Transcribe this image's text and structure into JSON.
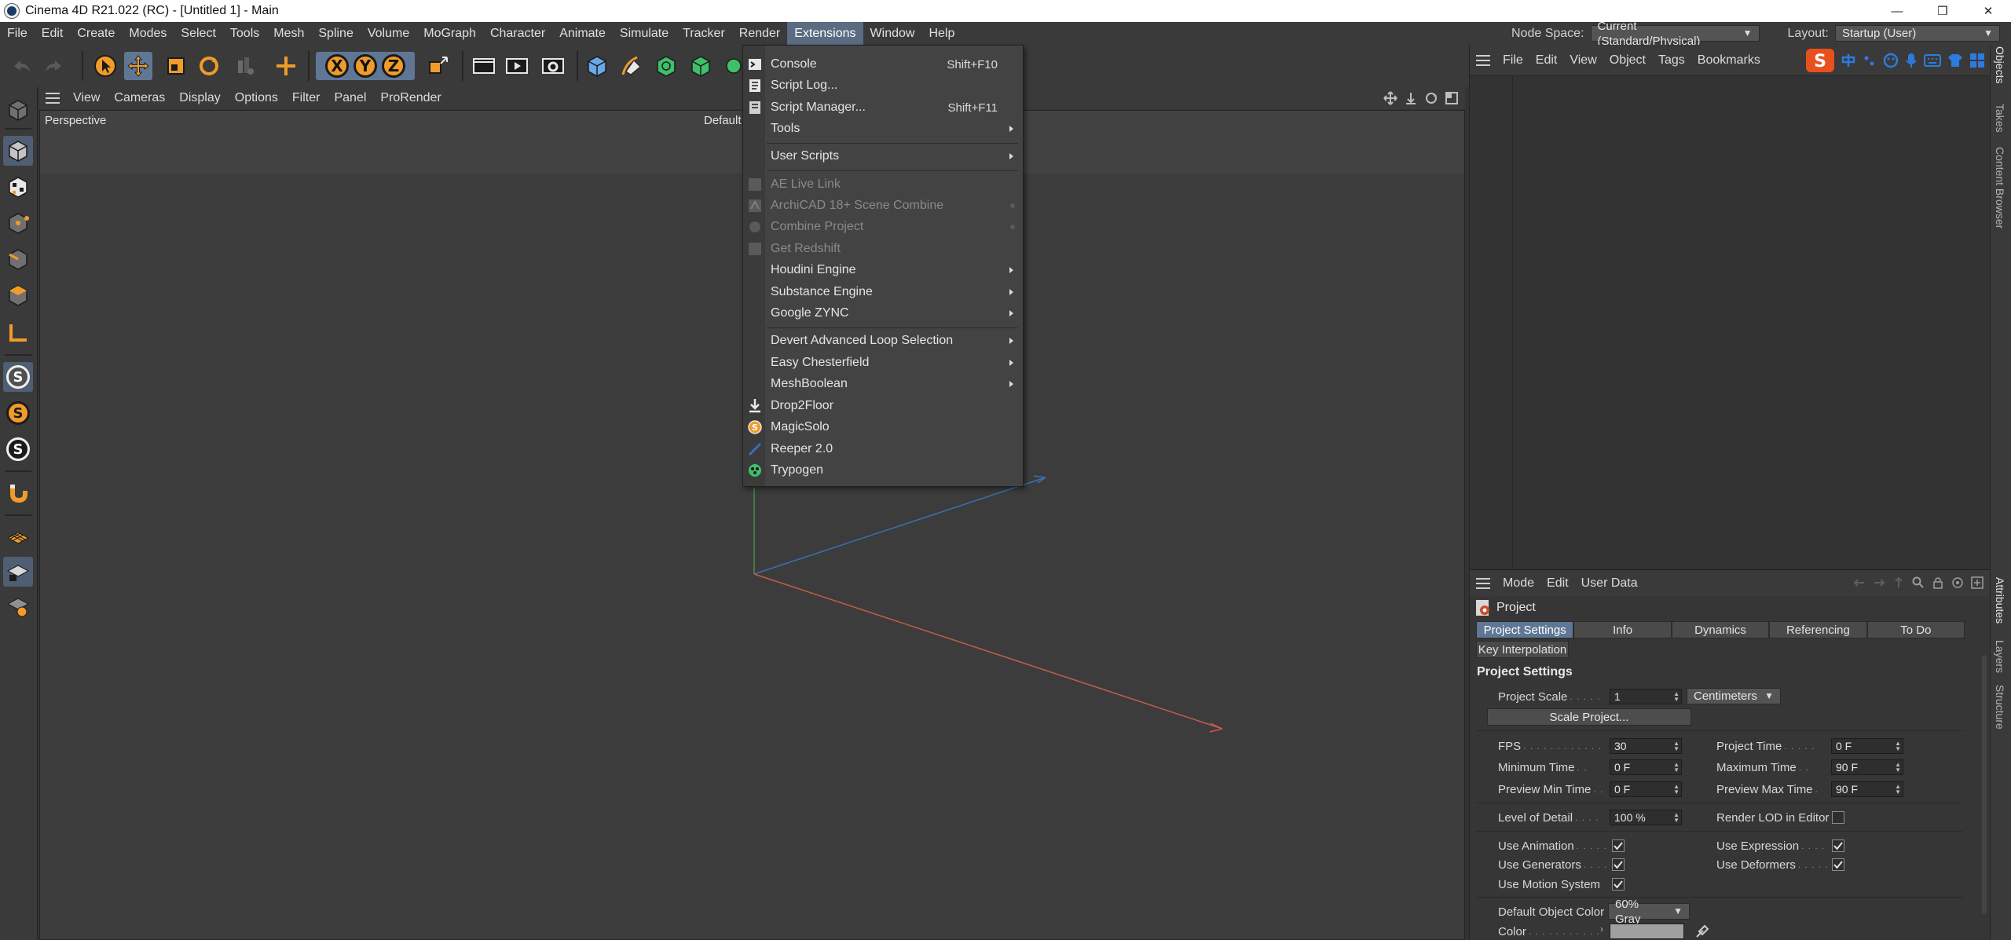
{
  "window": {
    "title": "Cinema 4D R21.022 (RC) - [Untitled 1] - Main",
    "controls": [
      "—",
      "❒",
      "✕"
    ]
  },
  "menubar": {
    "items": [
      "File",
      "Edit",
      "Create",
      "Modes",
      "Select",
      "Tools",
      "Mesh",
      "Spline",
      "Volume",
      "MoGraph",
      "Character",
      "Animate",
      "Simulate",
      "Tracker",
      "Render",
      "Extensions",
      "Window",
      "Help"
    ],
    "active": "Extensions",
    "node_space_label": "Node Space:",
    "node_space_value": "Current (Standard/Physical)",
    "layout_label": "Layout:",
    "layout_value": "Startup (User)"
  },
  "toolbar": {
    "axis_labels": [
      "X",
      "Y",
      "Z"
    ],
    "icons": [
      "undo-icon",
      "redo-icon",
      "live-selection-icon",
      "move-icon",
      "scale-icon",
      "rotate-icon",
      "recent-tools-icon",
      "world-coordinates-icon",
      "render-region-icon",
      "render-view-icon",
      "render-settings-icon",
      "cube-icon",
      "pen-icon",
      "subdivision-icon",
      "extrude-icon",
      "mograph-icon"
    ]
  },
  "left_toolbar": {
    "icons": [
      "make-editable-icon",
      "model-mode-icon",
      "texture-mode-icon",
      "points-mode-icon",
      "edges-mode-icon",
      "polygons-mode-icon",
      "axis-mode-icon",
      "solo-icon",
      "solo-hierarchy-icon",
      "solo-selection-icon",
      "snap-icon",
      "workplane-icon",
      "locked-workplane-icon",
      "planar-workplane-icon"
    ]
  },
  "viewport": {
    "menu": [
      "View",
      "Cameras",
      "Display",
      "Options",
      "Filter",
      "Panel",
      "ProRender"
    ],
    "camera_label": "Perspective",
    "default_label": "Default"
  },
  "extensions_menu": {
    "items": [
      {
        "label": "Console",
        "shortcut": "Shift+F10",
        "icon": "console-icon",
        "disabled": false,
        "submenu": false
      },
      {
        "label": "Script Log...",
        "shortcut": "",
        "icon": "script-log-icon",
        "disabled": false,
        "submenu": false
      },
      {
        "label": "Script Manager...",
        "shortcut": "Shift+F11",
        "icon": "script-manager-icon",
        "disabled": false,
        "submenu": false
      },
      {
        "label": "Tools",
        "shortcut": "",
        "icon": "",
        "disabled": false,
        "submenu": true
      },
      {
        "label": "User Scripts",
        "shortcut": "",
        "icon": "",
        "disabled": false,
        "submenu": true
      },
      {
        "label": "AE Live Link",
        "shortcut": "",
        "icon": "ae-live-link-icon",
        "disabled": true,
        "submenu": false
      },
      {
        "label": "ArchiCAD 18+ Scene Combine",
        "shortcut": "",
        "icon": "archicad-icon",
        "disabled": true,
        "submenu": false
      },
      {
        "label": "Combine Project",
        "shortcut": "",
        "icon": "combine-project-icon",
        "disabled": true,
        "submenu": false
      },
      {
        "label": "Get Redshift",
        "shortcut": "",
        "icon": "redshift-icon",
        "disabled": true,
        "submenu": false
      },
      {
        "label": "Houdini Engine",
        "shortcut": "",
        "icon": "",
        "disabled": false,
        "submenu": true
      },
      {
        "label": "Substance Engine",
        "shortcut": "",
        "icon": "",
        "disabled": false,
        "submenu": true
      },
      {
        "label": "Google ZYNC",
        "shortcut": "",
        "icon": "",
        "disabled": false,
        "submenu": true
      },
      {
        "label": "Devert Advanced Loop Selection",
        "shortcut": "",
        "icon": "",
        "disabled": false,
        "submenu": true
      },
      {
        "label": "Easy Chesterfield",
        "shortcut": "",
        "icon": "",
        "disabled": false,
        "submenu": true
      },
      {
        "label": "MeshBoolean",
        "shortcut": "",
        "icon": "",
        "disabled": false,
        "submenu": true
      },
      {
        "label": "Drop2Floor",
        "shortcut": "",
        "icon": "drop2floor-icon",
        "disabled": false,
        "submenu": false
      },
      {
        "label": "MagicSolo",
        "shortcut": "",
        "icon": "magicsolo-icon",
        "disabled": false,
        "submenu": false
      },
      {
        "label": "Reeper 2.0",
        "shortcut": "",
        "icon": "reeper-icon",
        "disabled": false,
        "submenu": false
      },
      {
        "label": "Trypogen",
        "shortcut": "",
        "icon": "trypogen-icon",
        "disabled": false,
        "submenu": false
      }
    ]
  },
  "object_manager": {
    "menu": [
      "File",
      "Edit",
      "View",
      "Object",
      "Tags",
      "Bookmarks"
    ]
  },
  "right_tabs": [
    "Objects",
    "Takes",
    "Content Browser",
    "Attributes",
    "Layers",
    "Structure"
  ],
  "attributes": {
    "menu": [
      "Mode",
      "Edit",
      "User Data"
    ],
    "object_title": "Project",
    "tabs": [
      "Project Settings",
      "Info",
      "Dynamics",
      "Referencing",
      "To Do"
    ],
    "active_tab": "Project Settings",
    "second_tab": "Key Interpolation",
    "section_title": "Project Settings",
    "project_scale_label": "Project Scale",
    "project_scale_value": "1",
    "project_scale_unit": "Centimeters",
    "scale_project_button": "Scale Project...",
    "fps_label": "FPS",
    "fps_value": "30",
    "project_time_label": "Project Time",
    "project_time_value": "0 F",
    "min_time_label": "Minimum Time",
    "min_time_value": "0 F",
    "max_time_label": "Maximum Time",
    "max_time_value": "90 F",
    "preview_min_label": "Preview Min Time",
    "preview_min_value": "0 F",
    "preview_max_label": "Preview Max Time",
    "preview_max_value": "90 F",
    "lod_label": "Level of Detail",
    "lod_value": "100 %",
    "render_lod_label": "Render LOD in Editor",
    "render_lod_checked": false,
    "use_animation_label": "Use Animation",
    "use_animation_checked": true,
    "use_expression_label": "Use Expression",
    "use_expression_checked": true,
    "use_generators_label": "Use Generators",
    "use_generators_checked": true,
    "use_deformers_label": "Use Deformers",
    "use_deformers_checked": true,
    "use_motion_label": "Use Motion System",
    "use_motion_checked": true,
    "default_color_label": "Default Object Color",
    "default_color_value": "60% Gray",
    "color_label": "Color",
    "color_swatch": "#a0a0a0"
  },
  "colors": {
    "accent_active": "#5f7795",
    "menu_highlight": "#5a6b82",
    "axis_x": "#c85a4b",
    "axis_y": "#4f8a4a",
    "axis_z": "#3b6fb8",
    "orange_icon": "#f09b2a"
  }
}
